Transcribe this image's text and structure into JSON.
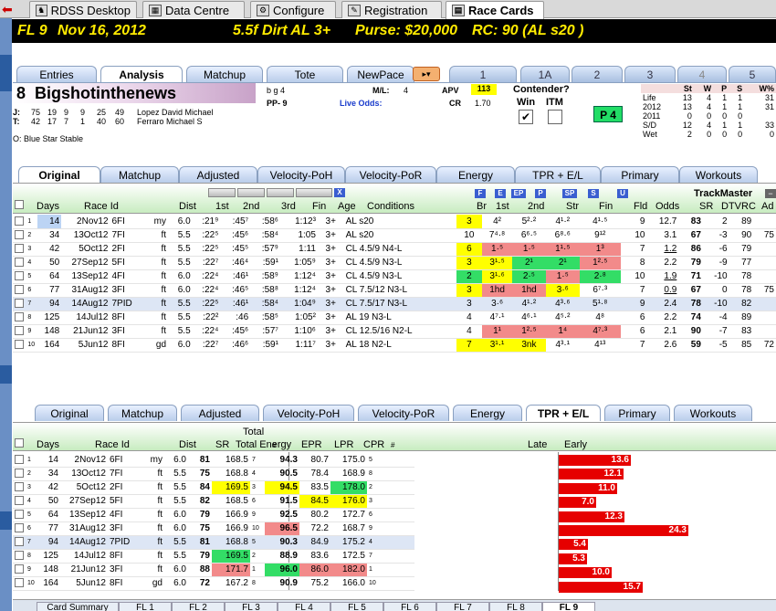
{
  "top_tabs": [
    {
      "label": "RDSS Desktop",
      "icon": "horse-icon"
    },
    {
      "label": "Data Centre",
      "icon": "data-icon"
    },
    {
      "label": "Configure",
      "icon": "gear-icon"
    },
    {
      "label": "Registration",
      "icon": "registration-icon"
    },
    {
      "label": "Race Cards",
      "icon": "racecard-icon",
      "active": true
    }
  ],
  "race_header": {
    "race": "FL 9",
    "date": "Nov 16, 2012",
    "details": "5.5f Dirt  AL  3+",
    "purse": "Purse: $20,000",
    "rc": "RC: 90  (AL s20 )"
  },
  "analysis_tabs": [
    "Entries",
    "Analysis",
    "Matchup",
    "Tote",
    "NewPace"
  ],
  "horse_tabs": [
    "1",
    "1A",
    "2",
    "3",
    "4",
    "5"
  ],
  "horse": {
    "number": "8",
    "name": "Bigshotinthenews",
    "sex_age": "b g 4",
    "pp": "PP- 9",
    "ml_label": "M/L:",
    "ml": "4",
    "live_odds": "Live Odds:",
    "apv_label": "APV",
    "apv": "113",
    "cr_label": "CR",
    "cr": "1.70",
    "jockey_row": [
      "J:",
      "75",
      "19",
      "9",
      "9",
      "25",
      "49",
      "Lopez David Michael"
    ],
    "trainer_row": [
      "T:",
      "42",
      "17",
      "7",
      "1",
      "40",
      "60",
      "Ferraro Michael S"
    ],
    "owner": "O:  Blue Star Stable",
    "contender": "Contender?",
    "win": "Win",
    "itm": "ITM",
    "p4": "P 4"
  },
  "record_box": {
    "headers": [
      "St",
      "W",
      "P",
      "S",
      "W%"
    ],
    "rows": [
      [
        "Life",
        "13",
        "4",
        "1",
        "1",
        "31"
      ],
      [
        "2012",
        "13",
        "4",
        "1",
        "1",
        "31"
      ],
      [
        "2011",
        "0",
        "0",
        "0",
        "0",
        ""
      ],
      [
        "S/D",
        "12",
        "4",
        "1",
        "1",
        "33"
      ],
      [
        "Wet",
        "2",
        "0",
        "0",
        "0",
        "0"
      ]
    ]
  },
  "pp_tabs": [
    "Original",
    "Matchup",
    "Adjusted",
    "Velocity-PoH",
    "Velocity-PoR",
    "Energy",
    "TPR + E/L",
    "Primary",
    "Workouts"
  ],
  "pp_grid": {
    "headers": [
      "Days",
      "Race Id",
      "Dist",
      "1st",
      "2nd",
      "3rd",
      "Fin",
      "Age",
      "Conditions",
      "Br",
      "1st",
      "2nd",
      "Str",
      "Fin",
      "Fld",
      "Odds",
      "SR",
      "DTV",
      "RC",
      "Ad"
    ],
    "trackmaster": "TrackMaster",
    "filter_buttons": [
      "F",
      "E",
      "EP",
      "P",
      "SP",
      "S",
      "U",
      "X"
    ],
    "rows": [
      {
        "n": "1",
        "days": "14",
        "date": "2Nov12",
        "trk": "6FI",
        "cond": "my",
        "dist": "6.0",
        "c1": ":21⁹",
        "c2": ":45⁷",
        "c3": ":58⁶",
        "fin": "1:12³",
        "age": "3+",
        "cls": "AL s20",
        "br": "3",
        "p1": "4²",
        "p2": "5²·²",
        "str": "4¹·²",
        "pf": "4¹·⁵",
        "fld": "9",
        "odds": "12.7",
        "sr": "83",
        "dtv": "2",
        "rc": "89",
        "ad": ""
      },
      {
        "n": "2",
        "days": "34",
        "date": "13Oct12",
        "trk": "7FI",
        "cond": "ft",
        "dist": "5.5",
        "c1": ":22⁵",
        "c2": ":45⁶",
        "c3": ":58⁴",
        "fin": "1:05",
        "age": "3+",
        "cls": "AL s20",
        "br": "10",
        "p1": "7⁴·⁸",
        "p2": "6⁶·⁵",
        "str": "6⁸·⁶",
        "pf": "9¹²",
        "fld": "10",
        "odds": "3.1",
        "sr": "67",
        "dtv": "-3",
        "rc": "90",
        "ad": "75"
      },
      {
        "n": "3",
        "days": "42",
        "date": "5Oct12",
        "trk": "2FI",
        "cond": "ft",
        "dist": "5.5",
        "c1": ":22⁵",
        "c2": ":45⁵",
        "c3": ":57⁹",
        "fin": "1:11",
        "age": "3+",
        "cls": "CL 4.5/9 N4-L",
        "br": "6",
        "p1": "1·⁵",
        "p2": "1·⁵",
        "str": "1¹·⁵",
        "pf": "1³",
        "fld": "7",
        "odds": "1.2",
        "sr": "86",
        "dtv": "-6",
        "rc": "79",
        "ad": ""
      },
      {
        "n": "4",
        "days": "50",
        "date": "27Sep12",
        "trk": "5FI",
        "cond": "ft",
        "dist": "5.5",
        "c1": ":22⁷",
        "c2": ":46⁴",
        "c3": ":59¹",
        "fin": "1:05⁹",
        "age": "3+",
        "cls": "CL 4.5/9 N3-L",
        "br": "3",
        "p1": "3¹·⁵",
        "p2": "2¹",
        "str": "2¹",
        "pf": "1²·⁵",
        "fld": "8",
        "odds": "2.2",
        "sr": "79",
        "dtv": "-9",
        "rc": "77",
        "ad": ""
      },
      {
        "n": "5",
        "days": "64",
        "date": "13Sep12",
        "trk": "4FI",
        "cond": "ft",
        "dist": "6.0",
        "c1": ":22⁴",
        "c2": ":46¹",
        "c3": ":58⁹",
        "fin": "1:12⁴",
        "age": "3+",
        "cls": "CL 4.5/9 N3-L",
        "br": "2",
        "p1": "3¹·⁶",
        "p2": "2·⁵",
        "str": "1·⁵",
        "pf": "2·⁸",
        "fld": "10",
        "odds": "1.9",
        "sr": "71",
        "dtv": "-10",
        "rc": "78",
        "ad": ""
      },
      {
        "n": "6",
        "days": "77",
        "date": "31Aug12",
        "trk": "3FI",
        "cond": "ft",
        "dist": "6.0",
        "c1": ":22⁴",
        "c2": ":46⁵",
        "c3": ":58⁸",
        "fin": "1:12⁴",
        "age": "3+",
        "cls": "CL 7.5/12 N3-L",
        "br": "3",
        "p1": "1hd",
        "p2": "1hd",
        "str": "3·⁶",
        "pf": "6⁷·³",
        "fld": "7",
        "odds": "0.9",
        "sr": "67",
        "dtv": "0",
        "rc": "78",
        "ad": "75"
      },
      {
        "n": "7",
        "days": "94",
        "sup": "31",
        "date": "14Aug12",
        "trk": "7PID",
        "cond": "ft",
        "dist": "5.5",
        "c1": ":22⁵",
        "c2": ":46¹",
        "c3": ":58⁴",
        "fin": "1:04⁹",
        "age": "3+",
        "cls": "CL 7.5/17 N3-L",
        "br": "3",
        "p1": "3·⁶",
        "p2": "4¹·²",
        "str": "4³·⁶",
        "pf": "5¹·⁸",
        "fld": "9",
        "odds": "2.4",
        "sr": "78",
        "dtv": "-10",
        "rc": "82",
        "ad": ""
      },
      {
        "n": "8",
        "days": "125",
        "date": "14Jul12",
        "trk": "8FI",
        "cond": "ft",
        "dist": "5.5",
        "c1": ":22²",
        "c2": ":46",
        "c3": ":58⁵",
        "fin": "1:05²",
        "age": "3+",
        "cls": "AL 19 N3-L",
        "br": "4",
        "p1": "4⁷·¹",
        "p2": "4⁶·¹",
        "str": "4⁵·²",
        "pf": "4⁸",
        "fld": "6",
        "odds": "2.2",
        "sr": "74",
        "dtv": "-4",
        "rc": "89",
        "ad": ""
      },
      {
        "n": "9",
        "days": "148",
        "date": "21Jun12",
        "trk": "3FI",
        "cond": "ft",
        "dist": "5.5",
        "c1": ":22⁴",
        "c2": ":45⁶",
        "c3": ":57⁷",
        "fin": "1:10⁶",
        "age": "3+",
        "cls": "CL 12.5/16 N2-L",
        "br": "4",
        "p1": "1¹",
        "p2": "1²·⁵",
        "str": "1⁴",
        "pf": "4⁷·³",
        "fld": "6",
        "odds": "2.1",
        "sr": "90",
        "dtv": "-7",
        "rc": "83",
        "ad": ""
      },
      {
        "n": "10",
        "days": "164",
        "date": "5Jun12",
        "trk": "8FI",
        "cond": "gd",
        "dist": "6.0",
        "c1": ":22⁷",
        "c2": ":46⁶",
        "c3": ":59¹",
        "fin": "1:11⁷",
        "age": "3+",
        "cls": "AL 18 N2-L",
        "br": "7",
        "p1": "3¹·¹",
        "p2": "3nk",
        "str": "4³·¹",
        "pf": "4¹³",
        "fld": "7",
        "odds": "2.6",
        "sr": "59",
        "dtv": "-5",
        "rc": "85",
        "ad": "72"
      }
    ]
  },
  "lower_tabs": [
    "Original",
    "Matchup",
    "Adjusted",
    "Velocity-PoH",
    "Velocity-PoR",
    "Energy",
    "TPR + E/L",
    "Primary",
    "Workouts"
  ],
  "tpr_grid": {
    "headers": [
      "Days",
      "Race Id",
      "Dist",
      "SR",
      "Total Energy",
      "#",
      "EPR",
      "LPR",
      "CPR",
      "#",
      "Late",
      "Early"
    ],
    "total_label": "Total",
    "rows": [
      {
        "n": "1",
        "days": "14",
        "date": "2Nov12",
        "trk": "6FI",
        "cond": "my",
        "dist": "6.0",
        "sr": "81",
        "te": "168.5",
        "ter": "7",
        "epr": "94.3",
        "lpr": "80.7",
        "cpr": "175.0",
        "cr": "5",
        "early": "13.6"
      },
      {
        "n": "2",
        "days": "34",
        "date": "13Oct12",
        "trk": "7FI",
        "cond": "ft",
        "dist": "5.5",
        "sr": "75",
        "te": "168.8",
        "ter": "4",
        "epr": "90.5",
        "lpr": "78.4",
        "cpr": "168.9",
        "cr": "8",
        "early": "12.1"
      },
      {
        "n": "3",
        "days": "42",
        "date": "5Oct12",
        "trk": "2FI",
        "cond": "ft",
        "dist": "5.5",
        "sr": "84",
        "te": "169.5",
        "ter": "3",
        "epr": "94.5",
        "lpr": "83.5",
        "cpr": "178.0",
        "cr": "2",
        "early": "11.0"
      },
      {
        "n": "4",
        "days": "50",
        "date": "27Sep12",
        "trk": "5FI",
        "cond": "ft",
        "dist": "5.5",
        "sr": "82",
        "te": "168.5",
        "ter": "6",
        "epr": "91.5",
        "lpr": "84.5",
        "cpr": "176.0",
        "cr": "3",
        "early": "7.0"
      },
      {
        "n": "5",
        "days": "64",
        "date": "13Sep12",
        "trk": "4FI",
        "cond": "ft",
        "dist": "6.0",
        "sr": "79",
        "te": "166.9",
        "ter": "9",
        "epr": "92.5",
        "lpr": "80.2",
        "cpr": "172.7",
        "cr": "6",
        "early": "12.3"
      },
      {
        "n": "6",
        "days": "77",
        "date": "31Aug12",
        "trk": "3FI",
        "cond": "ft",
        "dist": "6.0",
        "sr": "75",
        "te": "166.9",
        "ter": "10",
        "epr": "96.5",
        "lpr": "72.2",
        "cpr": "168.7",
        "cr": "9",
        "early": "24.3"
      },
      {
        "n": "7",
        "days": "94",
        "date": "14Aug12",
        "trk": "7PID",
        "cond": "ft",
        "dist": "5.5",
        "sr": "81",
        "te": "168.8",
        "ter": "5",
        "epr": "90.3",
        "lpr": "84.9",
        "cpr": "175.2",
        "cr": "4",
        "early": "5.4"
      },
      {
        "n": "8",
        "days": "125",
        "date": "14Jul12",
        "trk": "8FI",
        "cond": "ft",
        "dist": "5.5",
        "sr": "79",
        "te": "169.5",
        "ter": "2",
        "epr": "88.9",
        "lpr": "83.6",
        "cpr": "172.5",
        "cr": "7",
        "early": "5.3"
      },
      {
        "n": "9",
        "days": "148",
        "date": "21Jun12",
        "trk": "3FI",
        "cond": "ft",
        "dist": "6.0",
        "sr": "88",
        "te": "171.7",
        "ter": "1",
        "epr": "96.0",
        "lpr": "86.0",
        "cpr": "182.0",
        "cr": "1",
        "early": "10.0"
      },
      {
        "n": "10",
        "days": "164",
        "date": "5Jun12",
        "trk": "8FI",
        "cond": "gd",
        "dist": "6.0",
        "sr": "72",
        "te": "167.2",
        "ter": "8",
        "epr": "90.9",
        "lpr": "75.2",
        "cpr": "166.0",
        "cr": "10",
        "early": "15.7"
      }
    ]
  },
  "bottom_tabs": [
    "Card Summary",
    "FL 1",
    "FL 2",
    "FL 3",
    "FL 4",
    "FL 5",
    "FL 6",
    "FL 7",
    "FL 8",
    "FL 9"
  ],
  "colors": {
    "yellow": "#ffff00",
    "green": "#33dd66",
    "red": "#f28a8a",
    "bar": "#e60000",
    "header_bg": "#000000",
    "header_fg": "#ffeb00"
  }
}
